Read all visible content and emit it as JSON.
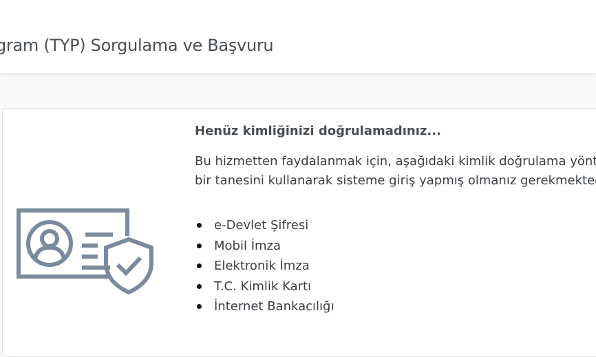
{
  "header": {
    "title": "gram (TYP) Sorgulama ve Başvuru"
  },
  "notice": {
    "title": "Henüz kimliğinizi doğrulamadınız...",
    "body_line1": "Bu hizmetten faydalanmak için, aşağıdaki kimlik doğrulama yönte",
    "body_line2": "bir tanesini kullanarak sisteme giriş yapmış olmanız gerekmektedi"
  },
  "methods": [
    {
      "label": "e-Devlet Şifresi"
    },
    {
      "label": "Mobil İmza"
    },
    {
      "label": "Elektronik İmza"
    },
    {
      "label": "T.C. Kimlik Kartı"
    },
    {
      "label": "İnternet Bankacılığı"
    }
  ],
  "illustration": {
    "icon": "id-card-shield-icon",
    "stroke_color": "#7b8a9c"
  }
}
